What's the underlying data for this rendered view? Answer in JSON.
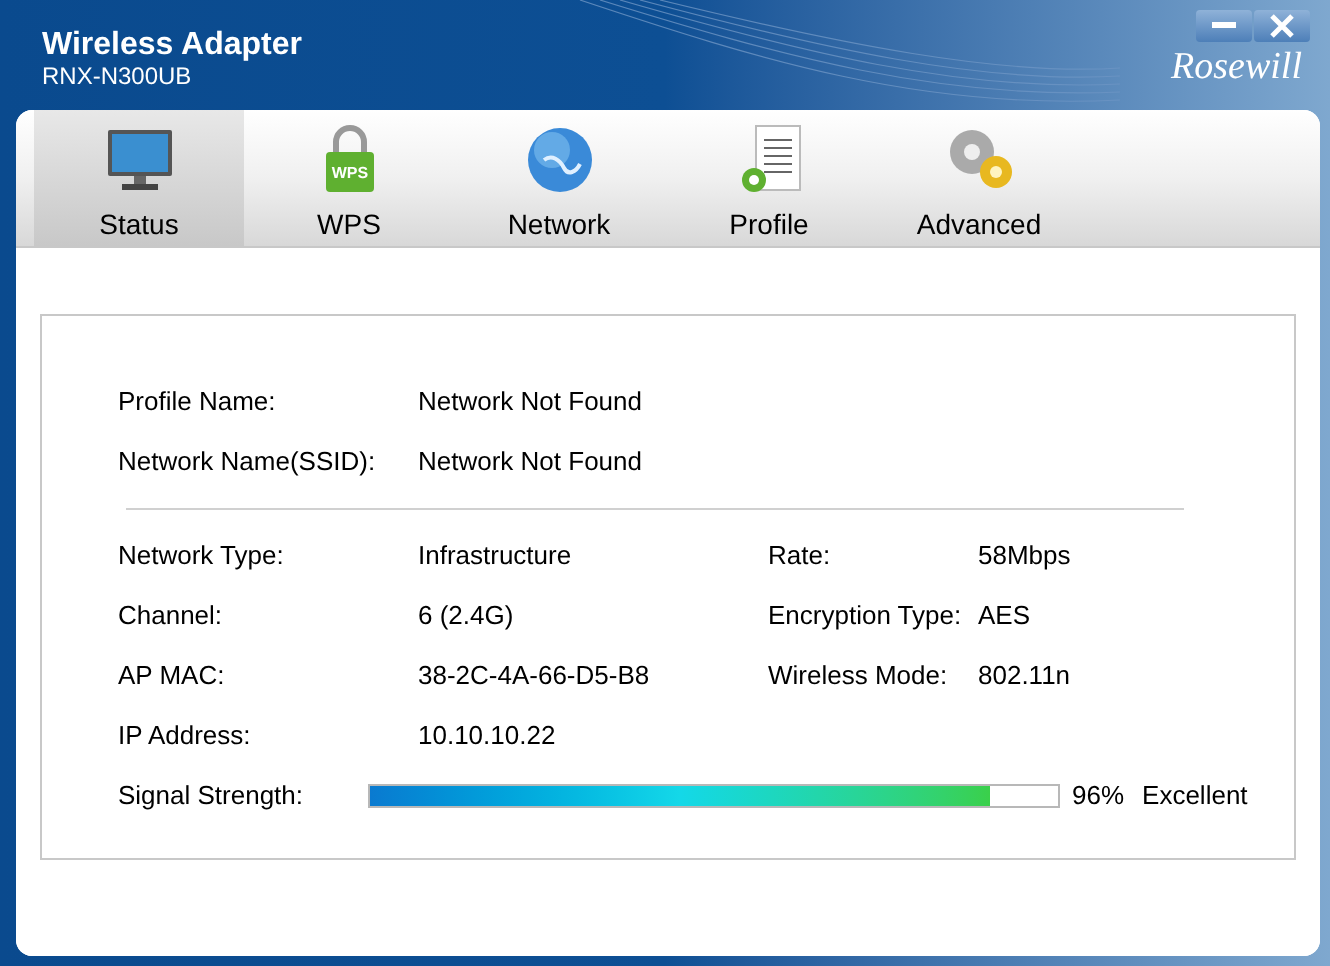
{
  "window": {
    "title": "Wireless Adapter",
    "subtitle": "RNX-N300UB",
    "logo": "Rosewill"
  },
  "tabs": [
    {
      "label": "Status",
      "selected": true
    },
    {
      "label": "WPS",
      "badge": "WPS",
      "selected": false
    },
    {
      "label": "Network",
      "selected": false
    },
    {
      "label": "Profile",
      "selected": false
    },
    {
      "label": "Advanced",
      "selected": false
    }
  ],
  "profile_rows": [
    {
      "label": "Profile Name:",
      "value": "Network Not Found"
    },
    {
      "label": "Network Name(SSID):",
      "value": "Network Not Found"
    }
  ],
  "detail_rows": [
    {
      "label": "Network Type:",
      "value": "Infrastructure",
      "right_label": "Rate:",
      "right_value": "58Mbps"
    },
    {
      "label": "Channel:",
      "value": "6 (2.4G)",
      "right_label": "Encryption Type:",
      "right_value": "AES"
    },
    {
      "label": "AP MAC:",
      "value": "38-2C-4A-66-D5-B8",
      "right_label": "Wireless Mode:",
      "right_value": "802.11n"
    },
    {
      "label": "IP Address:",
      "value": "10.10.10.22"
    }
  ],
  "signal": {
    "label": "Signal Strength:",
    "level": 0.9,
    "percent": "96%",
    "quality": "Excellent"
  }
}
